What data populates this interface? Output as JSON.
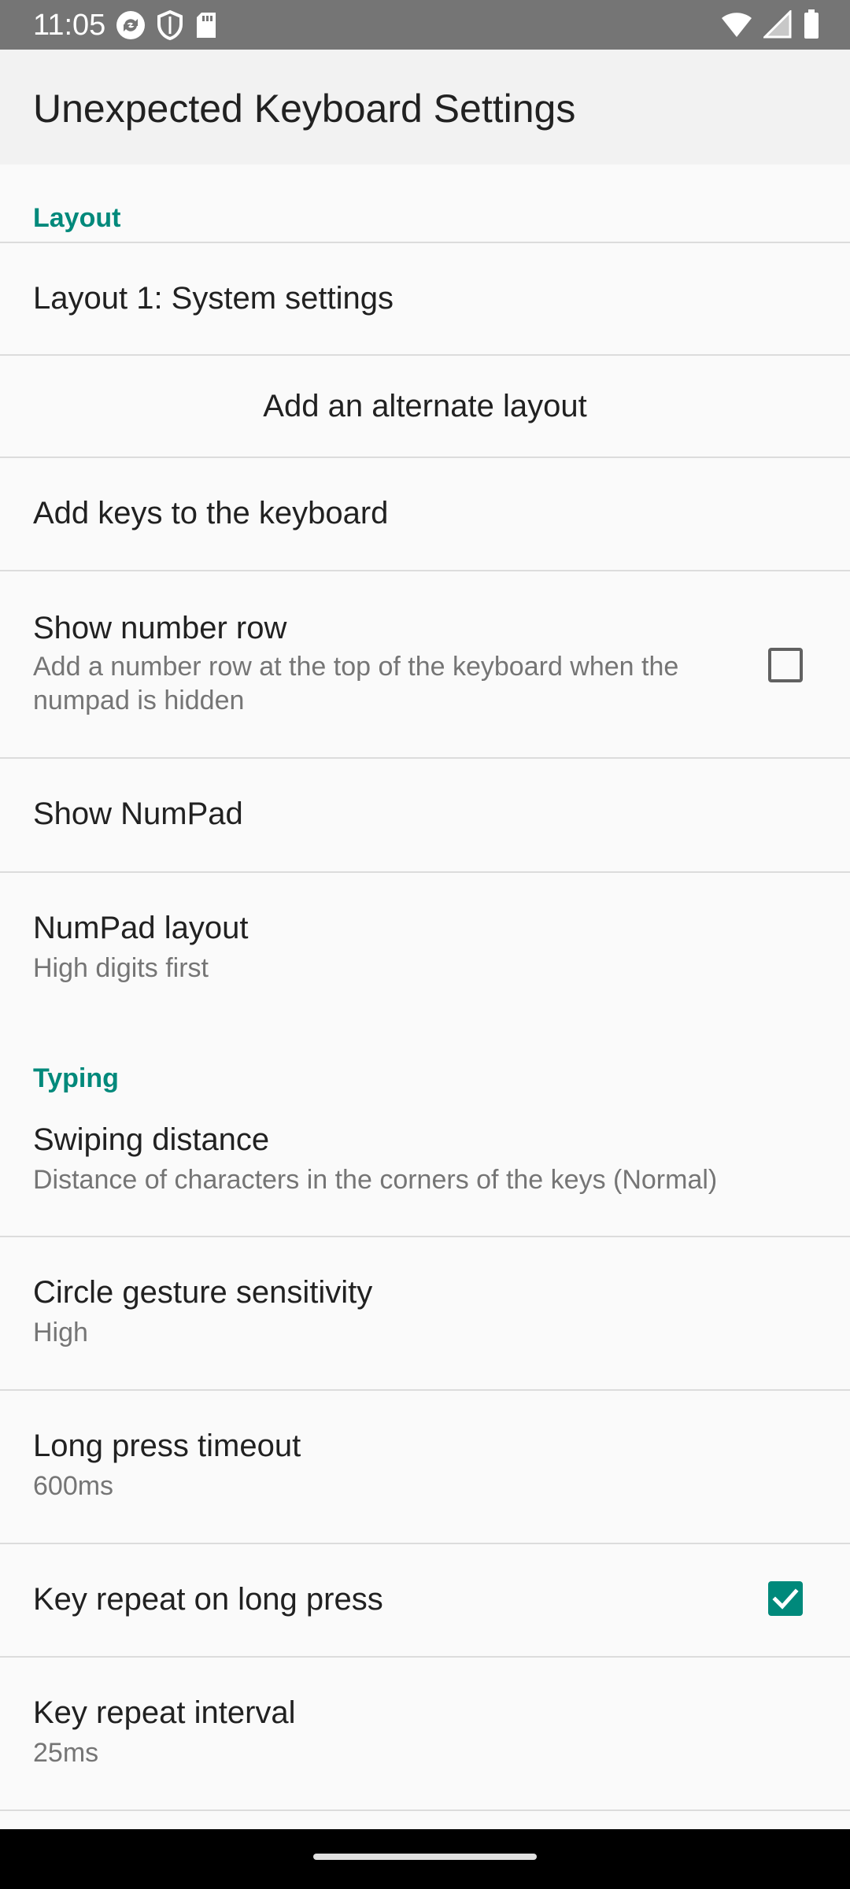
{
  "status_bar": {
    "time": "11:05",
    "left_icons": [
      "sync-icon",
      "shield-icon",
      "sd-card-icon"
    ],
    "right_icons": [
      "wifi-icon",
      "signal-icon",
      "battery-icon"
    ]
  },
  "app_bar": {
    "title": "Unexpected Keyboard Settings"
  },
  "sections": {
    "layout": {
      "header": "Layout",
      "layout1": "Layout 1: System settings",
      "add_alternate": "Add an alternate layout",
      "add_keys": "Add keys to the keyboard",
      "number_row_title": "Show number row",
      "number_row_summary": "Add a number row at the top of the keyboard when the numpad is hidden",
      "number_row_checked": false,
      "show_numpad": "Show NumPad",
      "numpad_layout_title": "NumPad layout",
      "numpad_layout_summary": "High digits first"
    },
    "typing": {
      "header": "Typing",
      "swipe_title": "Swiping distance",
      "swipe_summary": "Distance of characters in the corners of the keys (Normal)",
      "circle_title": "Circle gesture sensitivity",
      "circle_summary": "High",
      "longpress_title": "Long press timeout",
      "longpress_summary": "600ms",
      "keyrepeat_title": "Key repeat on long press",
      "keyrepeat_checked": true,
      "interval_title": "Key repeat interval",
      "interval_summary": "25ms"
    }
  },
  "colors": {
    "accent": "#00897b",
    "status_bar": "#757575",
    "app_bar": "#f2f2f2",
    "background": "#fafafa",
    "divider": "#dcdcdc",
    "summary_text": "#757575",
    "nav_bar": "#000000"
  }
}
